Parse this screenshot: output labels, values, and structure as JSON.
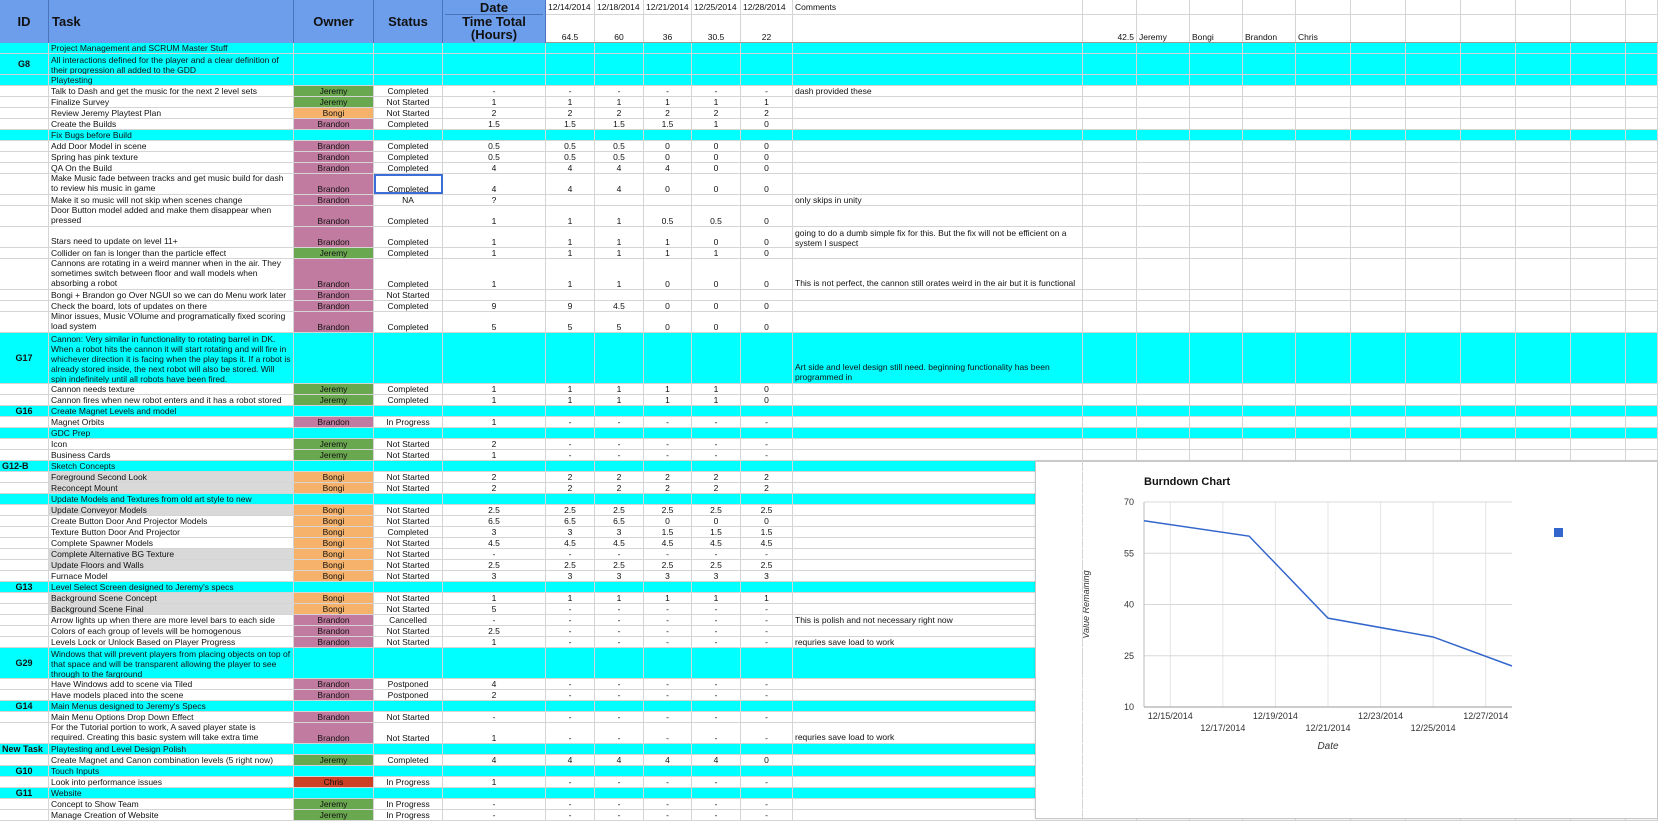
{
  "header": {
    "id": "ID",
    "task": "Task",
    "owner": "Owner",
    "status": "Status",
    "date": "Date",
    "time_total": "Time Total",
    "hours": "(Hours)",
    "dates": [
      "12/14/2014",
      "12/18/2014",
      "12/21/2014",
      "12/25/2014",
      "12/28/2014"
    ],
    "totals": [
      "64.5",
      "60",
      "36",
      "30.5",
      "22"
    ],
    "comments": "Comments",
    "extra_value": "42.5",
    "extra_names": [
      "Jeremy",
      "Bongi",
      "Brandon",
      "Chris"
    ]
  },
  "owner_colors": {
    "Jeremy": "#6aa84f",
    "Brandon": "#c27ba0",
    "Bongi": "#f6b26b",
    "Chris": "#cc4125"
  },
  "rows": [
    {
      "type": "section",
      "task": "Project Management and SCRUM Master Stuff"
    },
    {
      "type": "section",
      "id": "G8",
      "task": "All interactions defined for the player and a clear definition of their progression all added to the GDD",
      "h": 2
    },
    {
      "type": "section",
      "task": "Playtesting"
    },
    {
      "task": "Talk to Dash and get the music for the next 2 level sets",
      "owner": "Jeremy",
      "status": "Completed",
      "total": "-",
      "d": [
        "-",
        "-",
        "-",
        "-",
        "-"
      ],
      "comment": "dash provided these"
    },
    {
      "task": "Finalize Survey",
      "owner": "Jeremy",
      "status": "Not Started",
      "total": "1",
      "d": [
        "1",
        "1",
        "1",
        "1",
        "1"
      ]
    },
    {
      "task": "Review Jeremy Playtest Plan",
      "owner": "Bongi",
      "status": "Not Started",
      "total": "2",
      "d": [
        "2",
        "2",
        "2",
        "2",
        "2"
      ]
    },
    {
      "task": "Create the Builds",
      "owner": "Brandon",
      "status": "Completed",
      "total": "1.5",
      "d": [
        "1.5",
        "1.5",
        "1.5",
        "1",
        "0"
      ]
    },
    {
      "type": "section",
      "task": "Fix Bugs before Build"
    },
    {
      "task": "Add Door Model in scene",
      "owner": "Brandon",
      "status": "Completed",
      "total": "0.5",
      "d": [
        "0.5",
        "0.5",
        "0",
        "0",
        "0"
      ]
    },
    {
      "task": "Spring has pink texture",
      "owner": "Brandon",
      "status": "Completed",
      "total": "0.5",
      "d": [
        "0.5",
        "0.5",
        "0",
        "0",
        "0"
      ]
    },
    {
      "task": "QA On the Build",
      "owner": "Brandon",
      "status": "Completed",
      "total": "4",
      "d": [
        "4",
        "4",
        "4",
        "0",
        "0"
      ]
    },
    {
      "task": "Make Music fade between tracks and get music build for dash to review his music in game",
      "owner": "Brandon",
      "status": "Completed",
      "total": "4",
      "d": [
        "4",
        "4",
        "0",
        "0",
        "0"
      ],
      "h": 2,
      "selected": true
    },
    {
      "task": "Make it so music will not skip when scenes change",
      "owner": "Brandon",
      "status": "NA",
      "total": "?",
      "d": [
        "",
        "",
        "",
        "",
        ""
      ],
      "comment": "only skips in unity"
    },
    {
      "task": "Door Button model added and make them disappear when pressed",
      "owner": "Brandon",
      "status": "Completed",
      "total": "1",
      "d": [
        "1",
        "1",
        "0.5",
        "0.5",
        "0"
      ],
      "h": 2
    },
    {
      "task": "Stars need to update on level 11+",
      "owner": "Brandon",
      "status": "Completed",
      "total": "1",
      "d": [
        "1",
        "1",
        "1",
        "0",
        "0"
      ],
      "comment": "going to do a dumb simple fix for this. But the fix will not be efficient on a system I suspect",
      "h": 2,
      "comment_top": true
    },
    {
      "task": "Collider on fan is longer than the particle effect",
      "owner": "Jeremy",
      "status": "Completed",
      "total": "1",
      "d": [
        "1",
        "1",
        "1",
        "1",
        "0"
      ]
    },
    {
      "task": "Cannons are rotating in a weird manner when in the air. They sometimes switch between floor and wall models when absorbing a robot",
      "owner": "Brandon",
      "status": "Completed",
      "total": "1",
      "d": [
        "1",
        "1",
        "0",
        "0",
        "0"
      ],
      "comment": "This is not perfect, the cannon still orates weird in the air but it is functional",
      "h": 3
    },
    {
      "task": "Bongi + Brandon go Over NGUI so we can do Menu work later",
      "owner": "Brandon",
      "status": "Not Started",
      "total": "",
      "d": [
        "",
        "",
        "",
        "",
        ""
      ]
    },
    {
      "task": "Check the board, lots of updates on there",
      "owner": "Brandon",
      "status": "Completed",
      "total": "9",
      "d": [
        "9",
        "4.5",
        "0",
        "0",
        "0"
      ]
    },
    {
      "task": "Minor issues, Music VOlume and programatically fixed scoring load system",
      "owner": "Brandon",
      "status": "Completed",
      "total": "5",
      "d": [
        "5",
        "5",
        "0",
        "0",
        "0"
      ],
      "h": 2
    },
    {
      "type": "section",
      "id": "G17",
      "task": "Cannon: Very similar in functionality to rotating barrel in DK. When a robot hits the cannon it will start rotating and will fire in whichever direction it is facing when the play taps it. If a robot is already stored inside, the next robot will also be stored. Will spin indefinitely until all robots have been fired.",
      "comment": "Art side and level design still need. beginning functionality has been programmed in",
      "h": 5
    },
    {
      "task": "Cannon needs texture",
      "owner": "Jeremy",
      "status": "Completed",
      "total": "1",
      "d": [
        "1",
        "1",
        "1",
        "1",
        "0"
      ]
    },
    {
      "task": "Cannon fires when new robot enters and it has a robot stored",
      "owner": "Jeremy",
      "status": "Completed",
      "total": "1",
      "d": [
        "1",
        "1",
        "1",
        "1",
        "0"
      ]
    },
    {
      "type": "section",
      "id": "G16",
      "task": "Create Magnet Levels and model"
    },
    {
      "task": "Magnet Orbits",
      "owner": "Brandon",
      "status": "In Progress",
      "total": "1",
      "d": [
        "-",
        "-",
        "-",
        "-",
        "-"
      ]
    },
    {
      "type": "section",
      "task": "GDC Prep"
    },
    {
      "task": "Icon",
      "owner": "Jeremy",
      "status": "Not Started",
      "total": "2",
      "d": [
        "-",
        "-",
        "-",
        "-",
        "-"
      ]
    },
    {
      "task": "Business Cards",
      "owner": "Jeremy",
      "status": "Not Started",
      "total": "1",
      "d": [
        "-",
        "-",
        "-",
        "-",
        "-"
      ]
    },
    {
      "type": "section",
      "id": "G12-B",
      "id_left": true,
      "task": "Sketch Concepts"
    },
    {
      "task": "Foreground Second Look",
      "owner": "Bongi",
      "status": "Not Started",
      "total": "2",
      "d": [
        "2",
        "2",
        "2",
        "2",
        "2"
      ],
      "grey": true
    },
    {
      "task": "Reconcept Mount",
      "owner": "Bongi",
      "status": "Not Started",
      "total": "2",
      "d": [
        "2",
        "2",
        "2",
        "2",
        "2"
      ],
      "grey": true
    },
    {
      "type": "section",
      "task": "Update Models and Textures from old art style to new"
    },
    {
      "task": "Update Conveyor Models",
      "owner": "Bongi",
      "status": "Not Started",
      "total": "2.5",
      "d": [
        "2.5",
        "2.5",
        "2.5",
        "2.5",
        "2.5"
      ],
      "grey": true
    },
    {
      "task": "Create Button Door And Projector Models",
      "owner": "Bongi",
      "status": "Not Started",
      "total": "6.5",
      "d": [
        "6.5",
        "6.5",
        "0",
        "0",
        "0"
      ]
    },
    {
      "task": "Texture Button Door And Projector",
      "owner": "Bongi",
      "status": "Completed",
      "total": "3",
      "d": [
        "3",
        "3",
        "1.5",
        "1.5",
        "1.5"
      ]
    },
    {
      "task": "Complete Spawner Models",
      "owner": "Bongi",
      "status": "Not Started",
      "total": "4.5",
      "d": [
        "4.5",
        "4.5",
        "4.5",
        "4.5",
        "4.5"
      ]
    },
    {
      "task": "Complete Alternative BG Texture",
      "owner": "Bongi",
      "status": "Not Started",
      "total": "-",
      "d": [
        "-",
        "-",
        "-",
        "-",
        "-"
      ],
      "grey": true
    },
    {
      "task": "Update Floors and Walls",
      "owner": "Bongi",
      "status": "Not Started",
      "total": "2.5",
      "d": [
        "2.5",
        "2.5",
        "2.5",
        "2.5",
        "2.5"
      ],
      "grey": true
    },
    {
      "task": "Furnace Model",
      "owner": "Bongi",
      "status": "Not Started",
      "total": "3",
      "d": [
        "3",
        "3",
        "3",
        "3",
        "3"
      ]
    },
    {
      "type": "section",
      "id": "G13",
      "task": "Level Select Screen designed to Jeremy's specs"
    },
    {
      "task": "Background Scene Concept",
      "owner": "Bongi",
      "status": "Not Started",
      "total": "1",
      "d": [
        "1",
        "1",
        "1",
        "1",
        "1"
      ],
      "grey": true
    },
    {
      "task": "Background Scene Final",
      "owner": "Bongi",
      "status": "Not Started",
      "total": "5",
      "d": [
        "-",
        "-",
        "-",
        "-",
        "-"
      ],
      "grey": true
    },
    {
      "task": "Arrow lights up when there are more level bars to each side",
      "owner": "Brandon",
      "status": "Cancelled",
      "total": "-",
      "d": [
        "-",
        "-",
        "-",
        "-",
        "-"
      ],
      "comment": "This is polish and not necessary right now"
    },
    {
      "task": "Colors of each group of levels will be homogenous",
      "owner": "Brandon",
      "status": "Not Started",
      "total": "2.5",
      "d": [
        "-",
        "-",
        "-",
        "-",
        "-"
      ]
    },
    {
      "task": "Levels Lock or Unlock Based on Player Progress",
      "owner": "Brandon",
      "status": "Not Started",
      "total": "1",
      "d": [
        "-",
        "-",
        "-",
        "-",
        "-"
      ],
      "comment": "requries save load to work"
    },
    {
      "type": "section",
      "id": "G29",
      "task": "Windows that will prevent players from placing objects on top of that space and will be transparent allowing the player to see through to the farground",
      "h": 3
    },
    {
      "task": "Have Windows add to scene via Tiled",
      "owner": "Brandon",
      "status": "Postponed",
      "total": "4",
      "d": [
        "-",
        "-",
        "-",
        "-",
        "-"
      ]
    },
    {
      "task": "Have models placed into the scene",
      "owner": "Brandon",
      "status": "Postponed",
      "total": "2",
      "d": [
        "-",
        "-",
        "-",
        "-",
        "-"
      ]
    },
    {
      "type": "section",
      "id": "G14",
      "task": "Main Menus designed to Jeremy's Specs"
    },
    {
      "task": "Main Menu Options Drop Down Effect",
      "owner": "Brandon",
      "status": "Not Started",
      "total": "-",
      "d": [
        "-",
        "-",
        "-",
        "-",
        "-"
      ]
    },
    {
      "task": "For the Tutorial portion to work, A saved player state is required. Creating this basic system will take extra time",
      "owner": "Brandon",
      "status": "Not Started",
      "total": "1",
      "d": [
        "-",
        "-",
        "-",
        "-",
        "-"
      ],
      "comment": "requries save load to work",
      "h": 2
    },
    {
      "type": "section",
      "id": "New Task",
      "id_left": true,
      "task": "Playtesting and Level Design Polish"
    },
    {
      "task": "Create Magnet and Canon combination levels (5 right now)",
      "owner": "Jeremy",
      "status": "Completed",
      "total": "4",
      "d": [
        "4",
        "4",
        "4",
        "4",
        "0"
      ]
    },
    {
      "type": "section",
      "id": "G10",
      "task": "Touch Inputs"
    },
    {
      "task": "Look into performance issues",
      "owner": "Chris",
      "status": "In Progress",
      "total": "1",
      "d": [
        "-",
        "-",
        "-",
        "-",
        "-"
      ]
    },
    {
      "type": "section",
      "id": "G11",
      "task": "Website"
    },
    {
      "task": "Concept to Show Team",
      "owner": "Jeremy",
      "status": "In Progress",
      "total": "-",
      "d": [
        "-",
        "-",
        "-",
        "-",
        "-"
      ]
    },
    {
      "task": "Manage Creation of Website",
      "owner": "Jeremy",
      "status": "In Progress",
      "total": "-",
      "d": [
        "-",
        "-",
        "-",
        "-",
        "-"
      ]
    }
  ],
  "chart_data": {
    "type": "line",
    "title": "Burndown Chart",
    "xlabel": "Date",
    "ylabel": "Value Remaining",
    "x": [
      "12/14/2014",
      "12/18/2014",
      "12/21/2014",
      "12/25/2014",
      "12/28/2014"
    ],
    "series": [
      {
        "values": [
          64.5,
          60,
          36,
          30.5,
          22
        ],
        "color": "#3366cc"
      }
    ],
    "x_ticks_upper": [
      "12/15/2014",
      "12/19/2014",
      "12/23/2014",
      "12/27/2014"
    ],
    "x_ticks_lower": [
      "12/17/2014",
      "12/21/2014",
      "12/25/2014"
    ],
    "y_ticks": [
      10,
      25,
      40,
      55,
      70
    ],
    "ylim": [
      10,
      70
    ],
    "xlim": [
      "12/14/2014",
      "12/28/2014"
    ],
    "grid": true,
    "legend": "top-right"
  }
}
